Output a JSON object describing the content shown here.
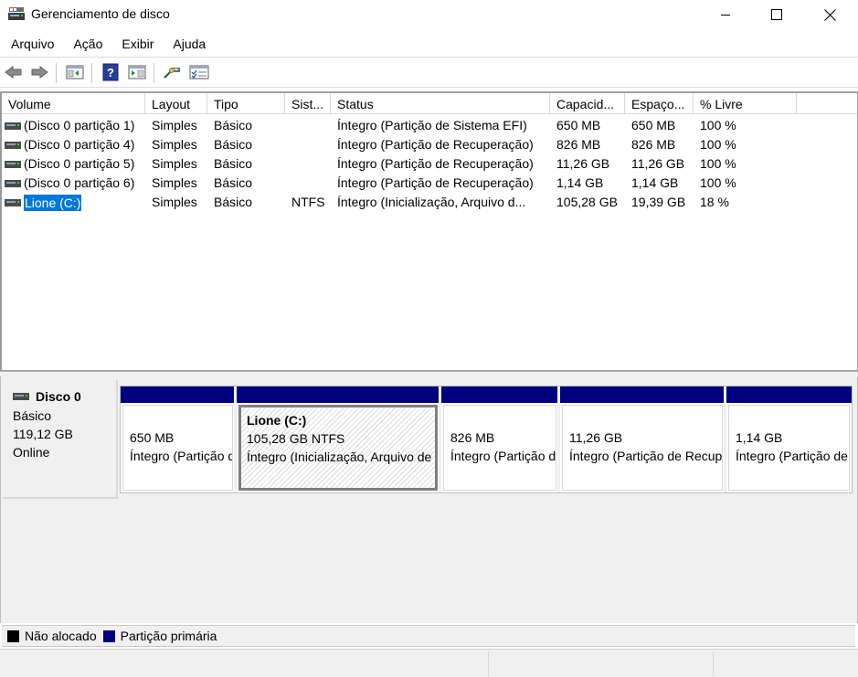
{
  "window": {
    "title": "Gerenciamento de disco",
    "minimize_icon": "minimize-icon",
    "maximize_icon": "maximize-icon",
    "close_icon": "close-icon"
  },
  "menu": [
    {
      "label": "Arquivo"
    },
    {
      "label": "Ação"
    },
    {
      "label": "Exibir"
    },
    {
      "label": "Ajuda"
    }
  ],
  "toolbar": {
    "icons": [
      "back-arrow-icon",
      "forward-arrow-icon",
      "console-tree-icon",
      "help-icon",
      "properties-panel-icon",
      "rescan-disks-icon",
      "checklist-icon"
    ]
  },
  "volume_list": {
    "columns": [
      "Volume",
      "Layout",
      "Tipo",
      "Sist...",
      "Status",
      "Capacid...",
      "Espaço...",
      "% Livre"
    ],
    "rows": [
      {
        "volume": "(Disco 0 partição 1)",
        "layout": "Simples",
        "tipo": "Básico",
        "sist": "",
        "status": "Íntegro (Partição de Sistema EFI)",
        "capacidade": "650 MB",
        "espaco": "650 MB",
        "livre": "100 %"
      },
      {
        "volume": "(Disco 0 partição 4)",
        "layout": "Simples",
        "tipo": "Básico",
        "sist": "",
        "status": "Íntegro (Partição de Recuperação)",
        "capacidade": "826 MB",
        "espaco": "826 MB",
        "livre": "100 %"
      },
      {
        "volume": "(Disco 0 partição 5)",
        "layout": "Simples",
        "tipo": "Básico",
        "sist": "",
        "status": "Íntegro (Partição de Recuperação)",
        "capacidade": "11,26 GB",
        "espaco": "11,26 GB",
        "livre": "100 %"
      },
      {
        "volume": "(Disco 0 partição 6)",
        "layout": "Simples",
        "tipo": "Básico",
        "sist": "",
        "status": "Íntegro (Partição de Recuperação)",
        "capacidade": "1,14 GB",
        "espaco": "1,14 GB",
        "livre": "100 %"
      },
      {
        "volume": "Lione (C:)",
        "layout": "Simples",
        "tipo": "Básico",
        "sist": "NTFS",
        "status": "Íntegro (Inicialização, Arquivo d...",
        "capacidade": "105,28 GB",
        "espaco": "19,39 GB",
        "livre": "18 %",
        "selected": true
      }
    ]
  },
  "disk": {
    "name": "Disco 0",
    "type": "Básico",
    "size": "119,12 GB",
    "state": "Online",
    "partitions": [
      {
        "line1": "650 MB",
        "line2": "Íntegro (Partição de Sistema EFI)"
      },
      {
        "title": "Lione  (C:)",
        "line1": "105,28 GB NTFS",
        "line2": "Íntegro (Inicialização, Arquivo de Paginação, Despejo de Memória, Partição Primária)",
        "selected": true
      },
      {
        "line1": "826 MB",
        "line2": "Íntegro (Partição de Recuperação)"
      },
      {
        "line1": "11,26 GB",
        "line2": "Íntegro (Partição de Recuperação)"
      },
      {
        "line1": "1,14 GB",
        "line2": "Íntegro (Partição de Recuperação)"
      }
    ]
  },
  "legend": [
    {
      "label": "Não alocado",
      "color": "#000000"
    },
    {
      "label": "Partição primária",
      "color": "#00007f"
    }
  ],
  "colors": {
    "primary_partition": "#00007f",
    "selection": "#0078d7"
  }
}
